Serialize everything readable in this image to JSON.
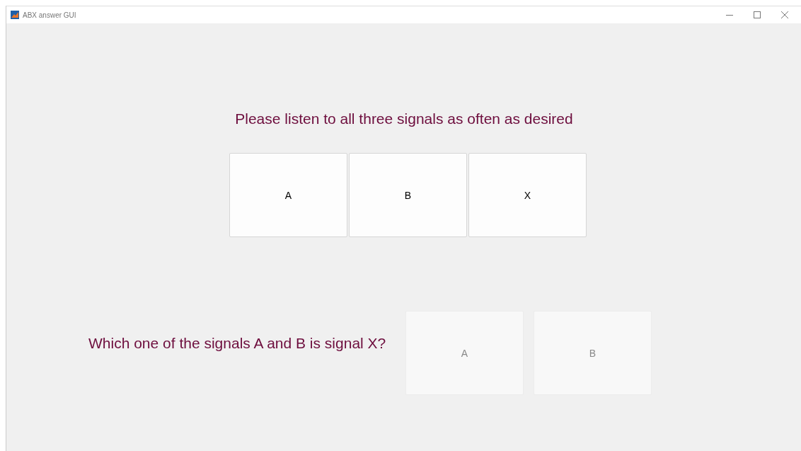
{
  "window": {
    "title": "ABX answer GUI"
  },
  "prompt": "Please listen to all three signals as often as desired",
  "signal_buttons": [
    {
      "label": "A",
      "disabled": false
    },
    {
      "label": "B",
      "disabled": false
    },
    {
      "label": "X",
      "disabled": false
    }
  ],
  "question": "Which one of the signals A and B is signal X?",
  "answer_buttons": [
    {
      "label": "A",
      "disabled": true
    },
    {
      "label": "B",
      "disabled": true
    }
  ]
}
